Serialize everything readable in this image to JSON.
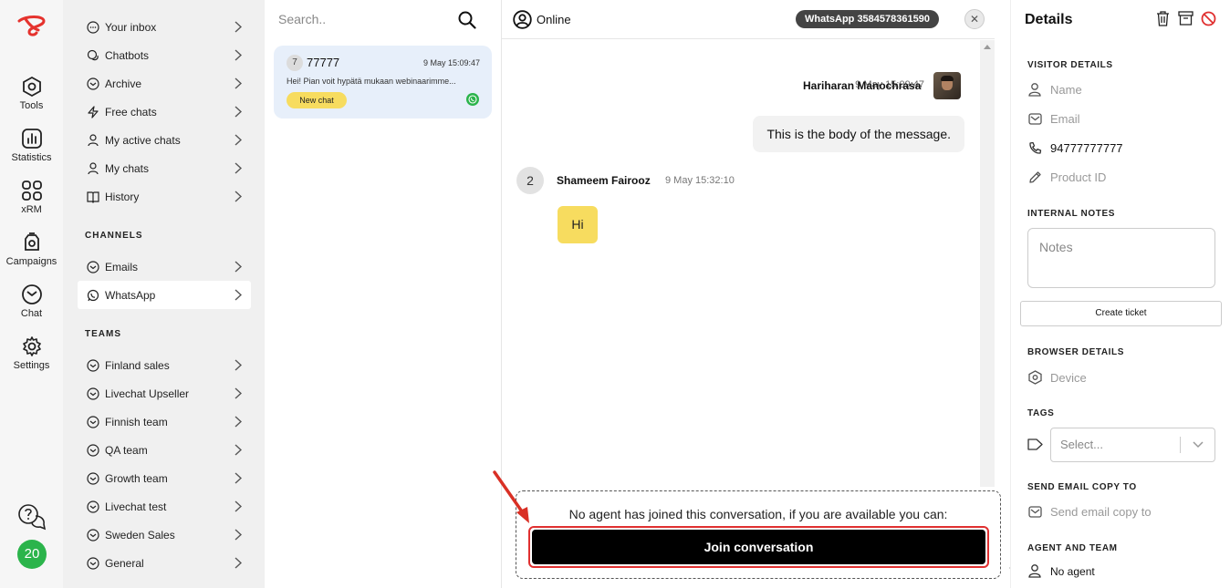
{
  "rail": {
    "items": [
      {
        "label": "Tools",
        "icon": "tools-icon"
      },
      {
        "label": "Statistics",
        "icon": "statistics-icon"
      },
      {
        "label": "xRM",
        "icon": "xrm-icon"
      },
      {
        "label": "Campaigns",
        "icon": "campaigns-icon"
      },
      {
        "label": "Chat",
        "icon": "chat-icon"
      },
      {
        "label": "Settings",
        "icon": "settings-icon"
      }
    ],
    "avatar_count": "20"
  },
  "sidebar": {
    "items": [
      {
        "label": "Your inbox"
      },
      {
        "label": "Chatbots"
      },
      {
        "label": "Archive"
      },
      {
        "label": "Free chats"
      },
      {
        "label": "My active chats"
      },
      {
        "label": "My chats"
      },
      {
        "label": "History"
      }
    ],
    "channels_heading": "CHANNELS",
    "channels": [
      {
        "label": "Emails"
      },
      {
        "label": "WhatsApp"
      }
    ],
    "teams_heading": "TEAMS",
    "teams": [
      {
        "label": "Finland sales"
      },
      {
        "label": "Livechat Upseller"
      },
      {
        "label": "Finnish team"
      },
      {
        "label": "QA team"
      },
      {
        "label": "Growth team"
      },
      {
        "label": "Livechat test"
      },
      {
        "label": "Sweden Sales"
      },
      {
        "label": "General"
      }
    ]
  },
  "chatlist": {
    "search_placeholder": "Search..",
    "card": {
      "count": "7",
      "name": "77777",
      "time": "9 May 15:09:47",
      "preview": "Hei! Pian voit hypätä mukaan webinaarimme...",
      "badge": "New chat"
    }
  },
  "conversation": {
    "status": "Online",
    "channel_pill": "WhatsApp 3584578361590",
    "close": "✕",
    "agent_message": {
      "time": "9 May 15:09:47",
      "author": "Hariharan Manochrasa",
      "text": "This is the body of the message."
    },
    "visitor_message": {
      "avatar": "2",
      "author": "Shameem Fairooz",
      "time": "9 May 15:32:10",
      "text": "Hi"
    },
    "join_notice": "No agent has joined this conversation, if you are available you can:",
    "join_button": "Join conversation"
  },
  "details": {
    "title": "Details",
    "visitor_heading": "VISITOR DETAILS",
    "name_placeholder": "Name",
    "email_placeholder": "Email",
    "phone": "94777777777",
    "product_placeholder": "Product ID",
    "notes_heading": "INTERNAL NOTES",
    "notes_placeholder": "Notes",
    "create_ticket": "Create ticket",
    "browser_heading": "BROWSER DETAILS",
    "device_placeholder": "Device",
    "tags_heading": "TAGS",
    "tags_placeholder": "Select...",
    "email_copy_heading": "SEND EMAIL COPY TO",
    "email_copy_placeholder": "Send email copy to",
    "agent_heading": "AGENT AND TEAM",
    "agent_value": "No agent"
  },
  "colors": {
    "accent_yellow": "#f7dc5f",
    "card_blue": "#e7effa",
    "online_green": "#2bb44b",
    "highlight_red": "#e03030",
    "logo_red": "#e5322d"
  }
}
